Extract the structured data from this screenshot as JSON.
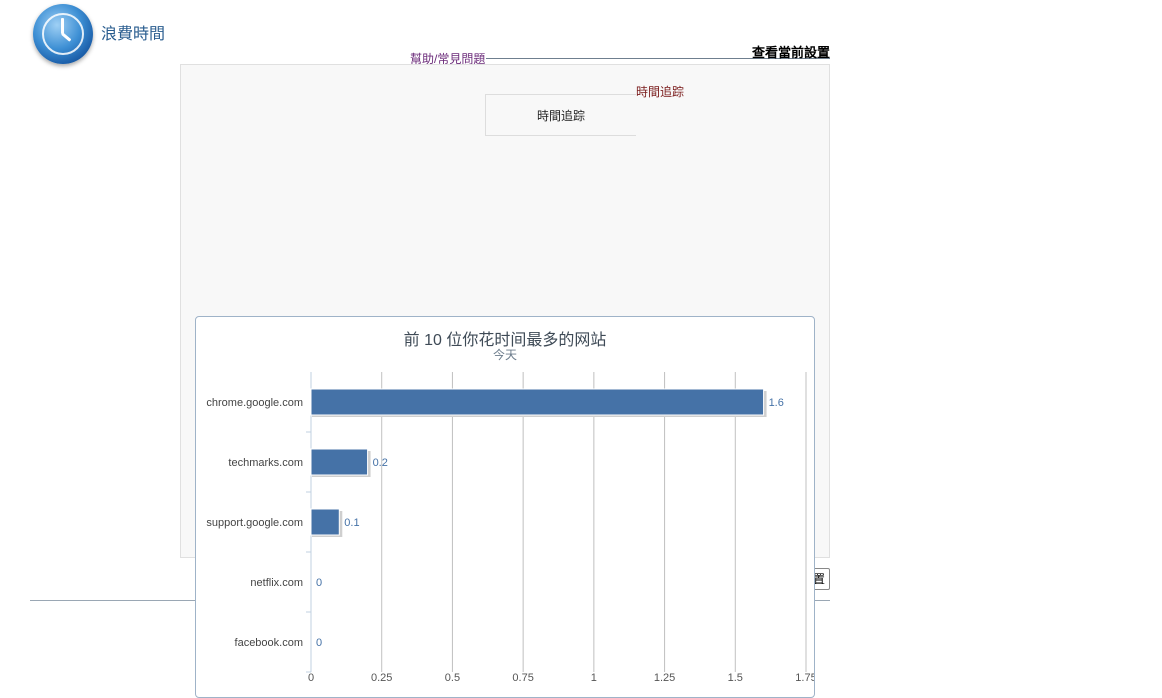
{
  "header": {
    "app_title": "浪費時間",
    "help_link": "幫助/常見問題",
    "settings_link": "查看當前設置"
  },
  "panel": {
    "tracking_box_label": "時間追踪",
    "tracking_link": "時間追踪"
  },
  "side_button_label": "置",
  "chart_data": {
    "type": "bar",
    "orientation": "horizontal",
    "title": "前 10 位你花时间最多的网站",
    "subtitle": "今天",
    "categories": [
      "chrome.google.com",
      "techmarks.com",
      "support.google.com",
      "netflix.com",
      "facebook.com"
    ],
    "values": [
      1.6,
      0.2,
      0.1,
      0,
      0
    ],
    "value_labels": [
      "1.6",
      "0.2",
      "0.1",
      "0",
      "0"
    ],
    "xlim": [
      0,
      1.75
    ],
    "xticks": [
      "0",
      "0.25",
      "0.5",
      "0.75",
      "1",
      "1.25",
      "1.5",
      "1.75"
    ],
    "grid": true,
    "bar_color": "#4572a7"
  }
}
